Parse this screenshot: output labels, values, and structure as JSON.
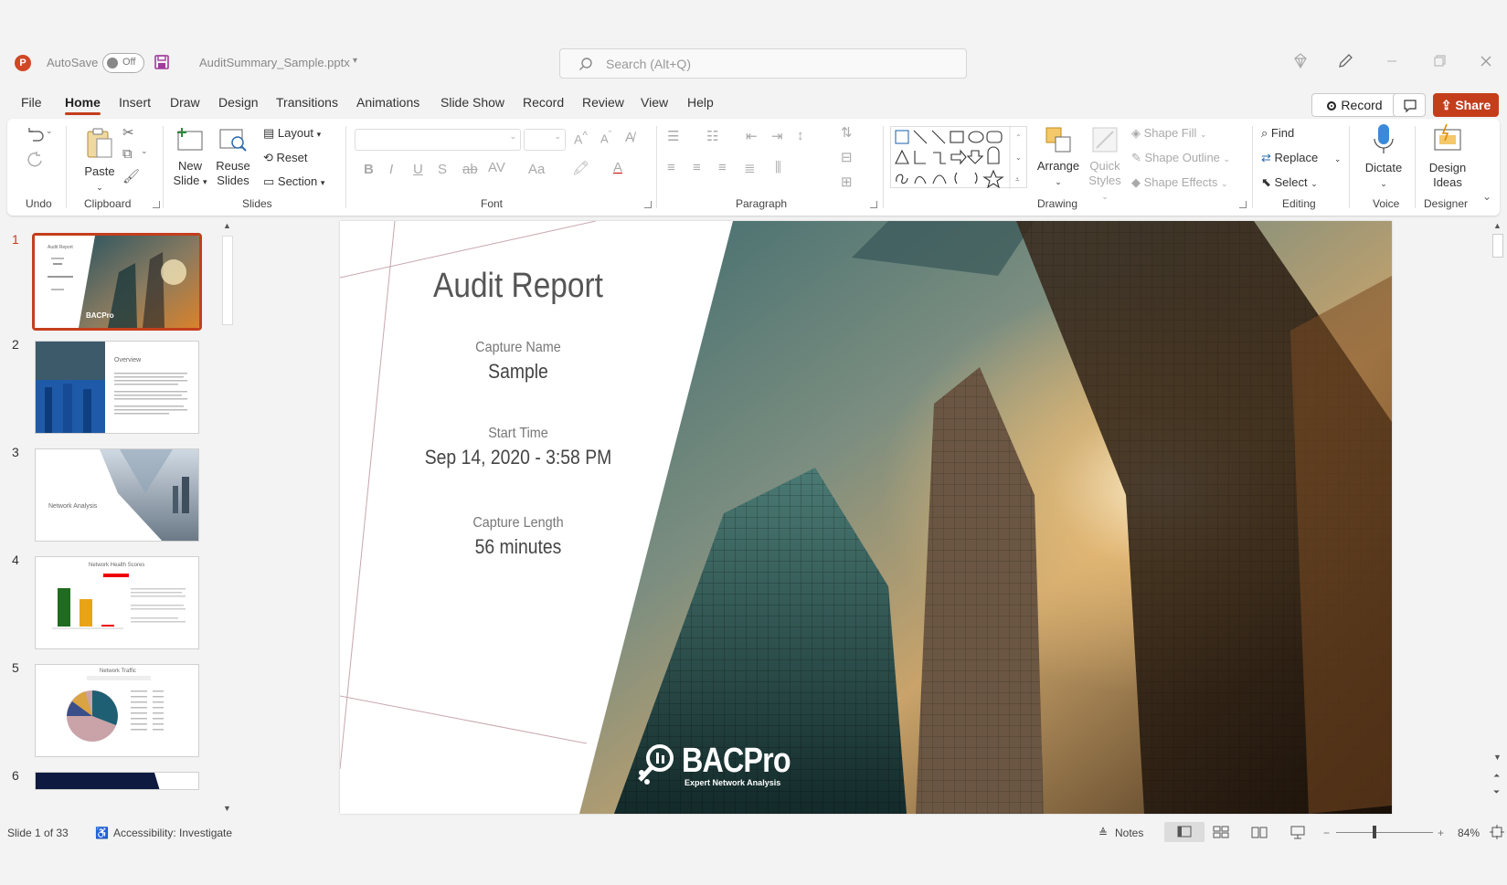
{
  "titlebar": {
    "autosave_label": "AutoSave",
    "autosave_state": "Off",
    "filename": "AuditSummary_Sample.pptx",
    "search_placeholder": "Search (Alt+Q)"
  },
  "menu": {
    "tabs": [
      "File",
      "Home",
      "Insert",
      "Draw",
      "Design",
      "Transitions",
      "Animations",
      "Slide Show",
      "Record",
      "Review",
      "View",
      "Help"
    ],
    "active_tab": "Home",
    "record_label": "Record",
    "share_label": "Share"
  },
  "ribbon": {
    "groups": {
      "undo": "Undo",
      "clipboard": "Clipboard",
      "slides": "Slides",
      "font": "Font",
      "paragraph": "Paragraph",
      "drawing": "Drawing",
      "editing": "Editing",
      "voice": "Voice",
      "designer": "Designer"
    },
    "paste": "Paste",
    "new_slide": [
      "New",
      "Slide"
    ],
    "reuse_slides": [
      "Reuse",
      "Slides"
    ],
    "layout": "Layout",
    "reset": "Reset",
    "section": "Section",
    "arrange": "Arrange",
    "quick_styles": [
      "Quick",
      "Styles"
    ],
    "shape_fill": "Shape Fill",
    "shape_outline": "Shape Outline",
    "shape_effects": "Shape Effects",
    "find": "Find",
    "replace": "Replace",
    "select": "Select",
    "dictate": "Dictate",
    "design_ideas": [
      "Design",
      "Ideas"
    ]
  },
  "thumbnails": {
    "numbers": [
      "1",
      "2",
      "3",
      "4",
      "5",
      "6"
    ],
    "selected": 1,
    "labels": {
      "t1_title": "Audit Report",
      "t2_title": "Overview",
      "t3_title": "Network Analysis",
      "t4_title": "Network Health Scores",
      "t5_title": "Network Traffic"
    }
  },
  "slide": {
    "title": "Audit Report",
    "capture_name_label": "Capture Name",
    "capture_name_value": "Sample",
    "start_time_label": "Start Time",
    "start_time_value": "Sep 14, 2020 - 3:58 PM",
    "capture_length_label": "Capture Length",
    "capture_length_value": "56 minutes",
    "logo_name": "BACPro",
    "logo_tagline": "Expert Network Analysis"
  },
  "status": {
    "slide_counter": "Slide 1 of 33",
    "accessibility": "Accessibility: Investigate",
    "notes": "Notes",
    "zoom": "84%",
    "zoom_fraction": 0.84
  },
  "colors": {
    "accent": "#c43e1c"
  }
}
